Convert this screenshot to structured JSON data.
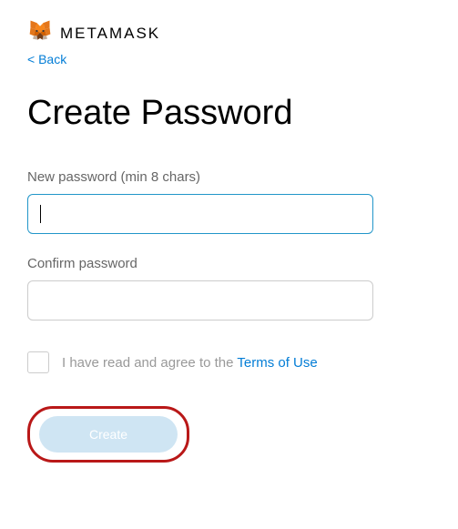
{
  "header": {
    "brand": "METAMASK",
    "back_label": "< Back"
  },
  "title": "Create Password",
  "fields": {
    "new_password": {
      "label": "New password (min 8 chars)",
      "value": ""
    },
    "confirm_password": {
      "label": "Confirm password",
      "value": ""
    }
  },
  "terms": {
    "text": "I have read and agree to the ",
    "link_text": "Terms of Use",
    "checked": false
  },
  "actions": {
    "create_label": "Create"
  },
  "icons": {
    "fox": "fox-icon"
  },
  "colors": {
    "accent": "#037dd6",
    "input_border_focus": "#2196c9",
    "disabled_btn": "#cfe5f3",
    "highlight_ring": "#b91818"
  }
}
